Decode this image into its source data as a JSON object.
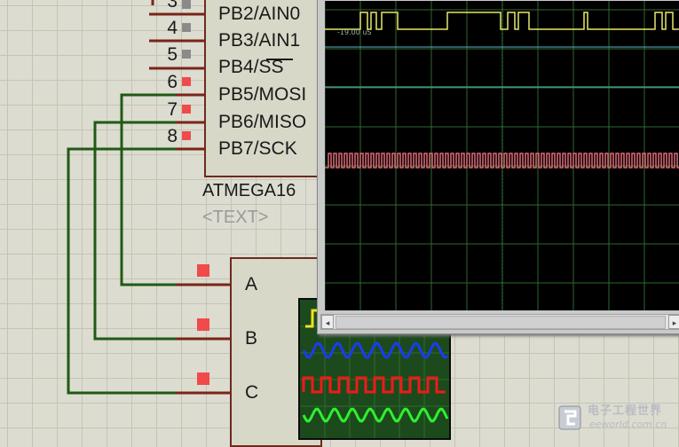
{
  "microcontroller": {
    "name": "ATMEGA16",
    "text_placeholder": "<TEXT>",
    "pins": [
      {
        "number": "3",
        "label": "PB2/AIN0",
        "state": "gray"
      },
      {
        "number": "4",
        "label": "PB3/AIN1",
        "state": "gray"
      },
      {
        "number": "5",
        "label": "PB4/SS",
        "state": "gray"
      },
      {
        "number": "6",
        "label": "PB5/MOSI",
        "state": "red"
      },
      {
        "number": "7",
        "label": "PB6/MISO",
        "state": "red"
      },
      {
        "number": "8",
        "label": "PB7/SCK",
        "state": "red"
      }
    ]
  },
  "scope_instrument": {
    "channels": [
      "A",
      "B",
      "C"
    ],
    "channel_state": "red"
  },
  "oscilloscope": {
    "time_label": "-19.00 uS",
    "trace_colors": {
      "yellow": "#e8e86a",
      "pink": "#e06a78",
      "cyan": "#58b8c8"
    },
    "grid_color": "#2e6a2e"
  },
  "mini_display": {
    "trace_colors": [
      "#f0e020",
      "#1a3cf0",
      "#f01a1a",
      "#2ef02e"
    ]
  },
  "watermark": {
    "brand_cn": "电子工程世界",
    "brand_en": "eeworld.com.cn"
  },
  "colors": {
    "wire": "#1f5a14",
    "pin_line": "#7a2418",
    "active_pin": "#f04a4a",
    "inactive_pin": "#8a8a8a"
  }
}
